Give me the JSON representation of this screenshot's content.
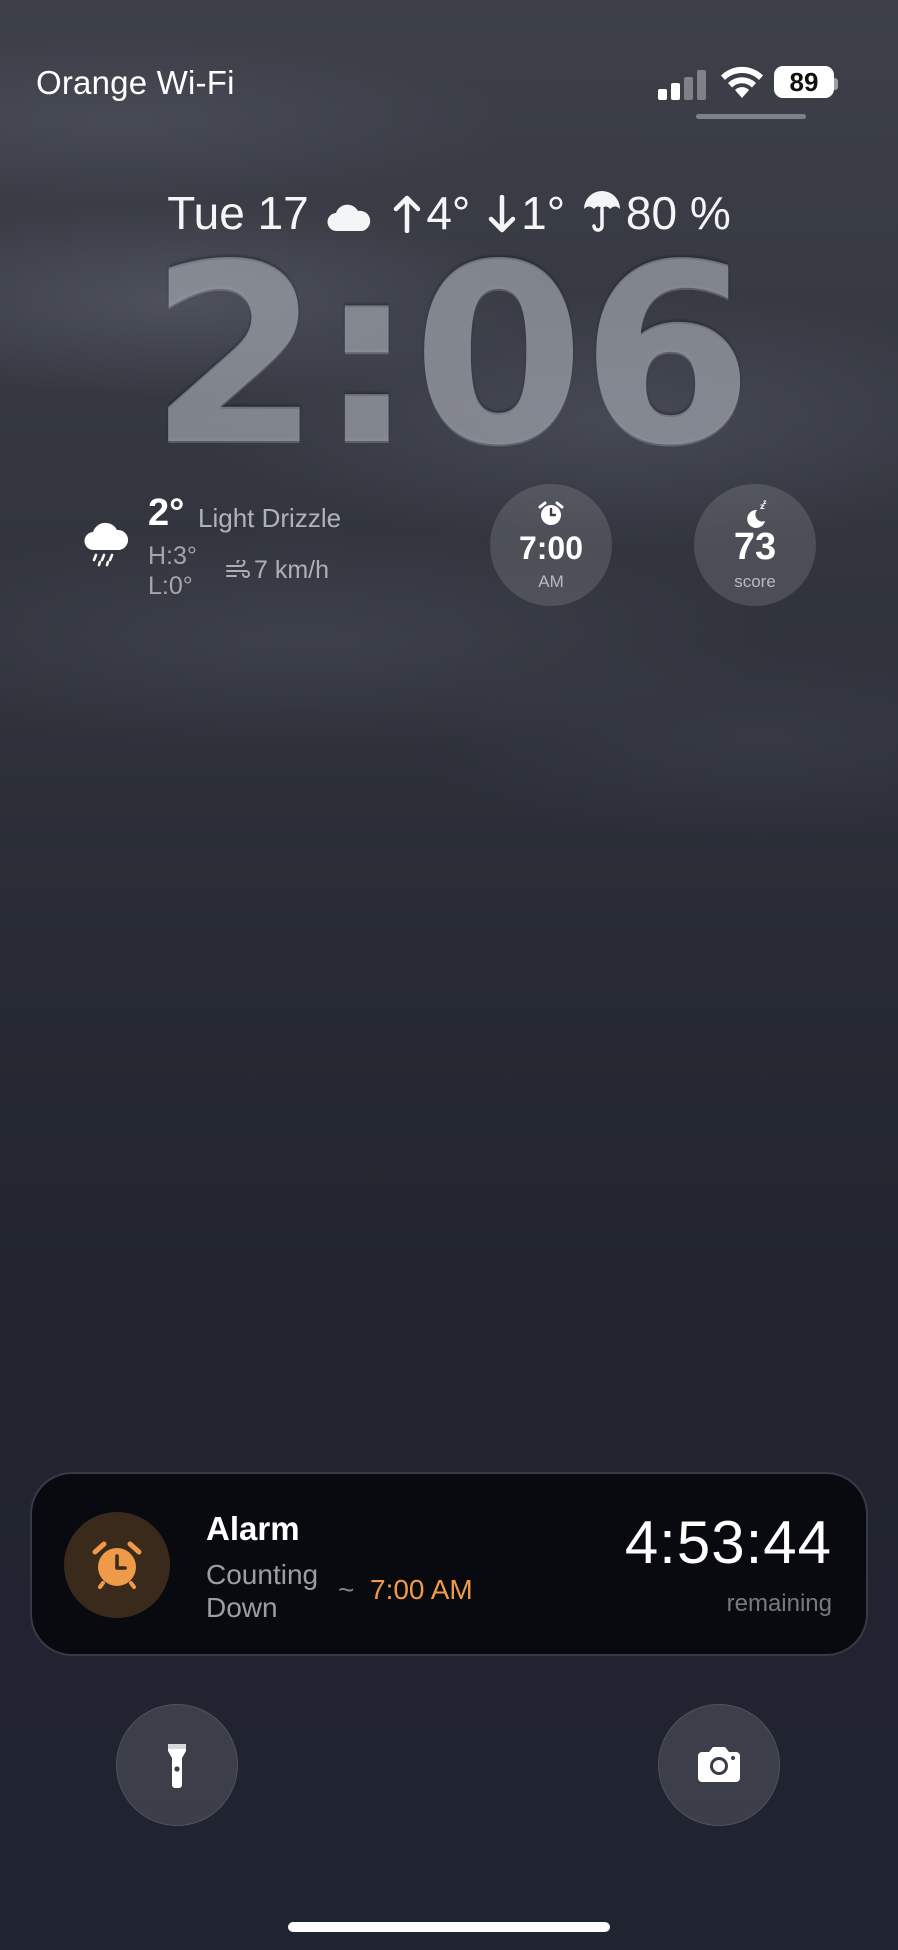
{
  "status_bar": {
    "carrier": "Orange Wi-Fi",
    "battery_level": "89",
    "icons": [
      "cellular-signal-icon",
      "wifi-icon",
      "battery-icon"
    ]
  },
  "date_line": {
    "date": "Tue 17",
    "high": "4°",
    "low": "1°",
    "precipitation": "80 %",
    "icons": [
      "cloud-icon",
      "arrow-up-icon",
      "arrow-down-icon",
      "umbrella-icon"
    ]
  },
  "clock": {
    "time": "2:06"
  },
  "weather_widget": {
    "temperature": "2°",
    "condition": "Light Drizzle",
    "high": "H:3°",
    "low": "L:0°",
    "wind": "7 km/h",
    "icons": [
      "rain-cloud-icon",
      "wind-icon"
    ]
  },
  "alarm_widget": {
    "time": "7:00",
    "period": "AM",
    "icon": "alarm-clock-icon"
  },
  "sleep_widget": {
    "value": "73",
    "label": "score",
    "icon": "moon-zzz-icon"
  },
  "live_activity": {
    "title": "Alarm",
    "status": "Counting Down",
    "tilde": "~",
    "alarm_time": "7:00 AM",
    "countdown": "4:53:44",
    "remaining_label": "remaining",
    "accent_color": "#ef9a49",
    "icon": "alarm-clock-icon"
  },
  "quick_actions": {
    "left": "flashlight-icon",
    "right": "camera-icon"
  }
}
